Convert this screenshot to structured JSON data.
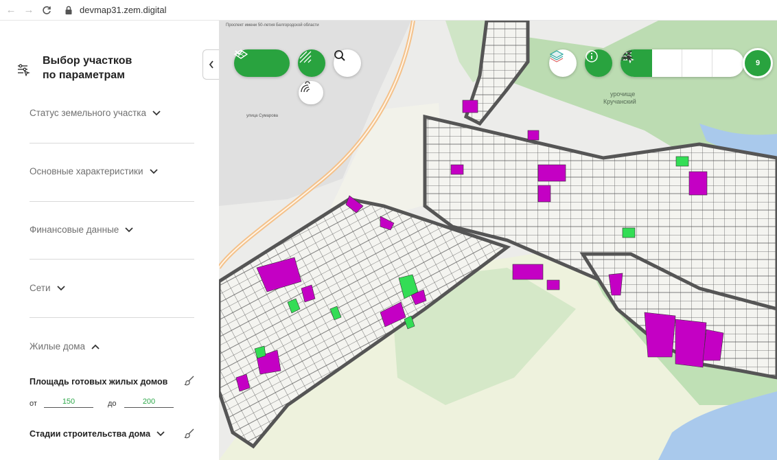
{
  "browser": {
    "url": "devmap31.zem.digital"
  },
  "sidebar": {
    "title_line1": "Выбор участков",
    "title_line2": "по параметрам",
    "sections": [
      {
        "label": "Статус земельного участка",
        "expanded": false
      },
      {
        "label": "Основные характеристики",
        "expanded": false
      },
      {
        "label": "Финансовые данные",
        "expanded": false
      },
      {
        "label": "Сети",
        "expanded": false
      },
      {
        "label": "Жилые дома",
        "expanded": true
      }
    ],
    "housing": {
      "area_label": "Площадь готовых жилых домов",
      "from_label": "от",
      "from_value": "150",
      "to_label": "до",
      "to_value": "200",
      "stages_label": "Стадии строительства дома"
    }
  },
  "map": {
    "labels": {
      "street1": "Проспект имени 50-летия Белгородской области",
      "street2": "улица Сумарова",
      "tract": "урочище",
      "tract_name": "Кручанский"
    },
    "selection_count": "9",
    "colors": {
      "accent": "#29a33f",
      "highlight_magenta": "#c400c4",
      "highlight_green": "#33dd55"
    }
  },
  "icons": {
    "back": "arrow-left-icon",
    "forward": "arrow-right-icon",
    "reload": "reload-icon",
    "lock": "lock-icon",
    "filter": "filter-icon",
    "layers_dropdown": "layers-icon",
    "hatch": "hatch-icon",
    "search": "search-icon",
    "fountain": "fountain-icon",
    "basemap": "basemap-icon",
    "info": "info-icon",
    "select": "select-icon",
    "deselect": "deselect-icon",
    "collapse": "collapse-icon"
  }
}
